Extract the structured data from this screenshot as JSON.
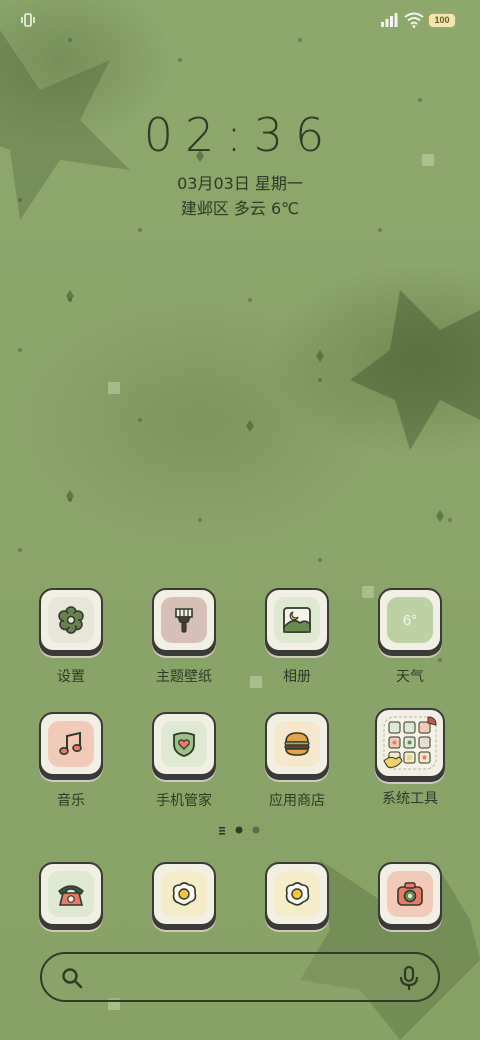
{
  "status_bar": {
    "battery": "100"
  },
  "lock": {
    "time": "02:36",
    "date": "03月03日 星期一",
    "weather": "建邺区 多云 6℃"
  },
  "apps_row1": [
    {
      "label": "设置",
      "icon": "gear-icon"
    },
    {
      "label": "主题壁纸",
      "icon": "paint-brush-icon"
    },
    {
      "label": "相册",
      "icon": "gallery-icon"
    },
    {
      "label": "天气",
      "icon": "weather-icon",
      "badge": "6°"
    }
  ],
  "apps_row2": [
    {
      "label": "音乐",
      "icon": "music-icon"
    },
    {
      "label": "手机管家",
      "icon": "shield-heart-icon"
    },
    {
      "label": "应用商店",
      "icon": "burger-icon"
    },
    {
      "label": "系统工具",
      "icon": "folder-icon"
    }
  ],
  "dock": [
    {
      "icon": "phone-icon"
    },
    {
      "icon": "fried-egg-icon"
    },
    {
      "icon": "fried-egg-icon"
    },
    {
      "icon": "camera-icon"
    }
  ],
  "colors": {
    "wallpaper": "#8aa56a",
    "outline": "#3a3a36",
    "text": "#2f3a28"
  }
}
